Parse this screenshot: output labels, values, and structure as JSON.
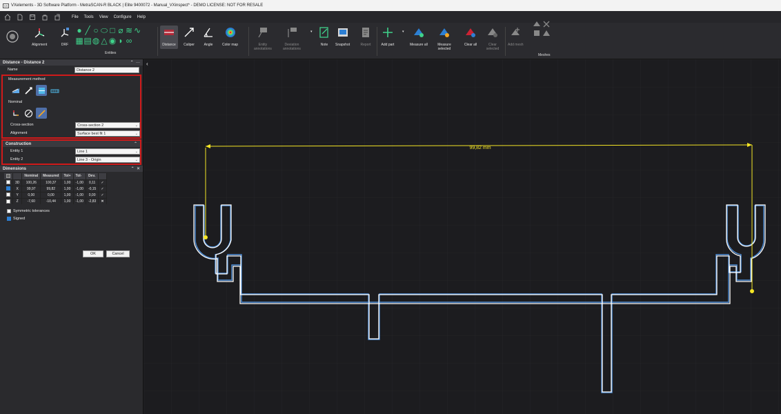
{
  "window": {
    "title": "VXelements - 3D Software Platform - MetraSCAN-R BLACK | Elite 9400072 - Manual_VXinspect* - DEMO LICENSE: NOT FOR RESALE",
    "logo_text": "VX"
  },
  "menu": [
    "File",
    "Tools",
    "View",
    "Configure",
    "Help"
  ],
  "ribbon": {
    "alignment": "Alignment",
    "drf": "DRF",
    "entities_group": "Entities",
    "distance": "Distance",
    "caliper": "Caliper",
    "angle": "Angle",
    "color_map": "Color map",
    "entity_annotations": "Entity\nannotations",
    "deviation_annotations": "Deviation\nannotations",
    "note": "Note",
    "snapshot": "Snapshot",
    "report": "Report",
    "add_part": "Add part",
    "measure_all": "Measure all",
    "measure_selected": "Measure\nselected",
    "clear_all": "Clear all",
    "clear_selected": "Clear\nselected",
    "add_mesh": "Add mesh",
    "meshes_group": "Meshes"
  },
  "panel": {
    "header": "Distance - Distance 2",
    "name_label": "Name",
    "name_value": "Distance 2",
    "measurement_method_label": "Measurement method",
    "nominal_label": "Nominal",
    "cross_section_label": "Cross-section",
    "cross_section_value": "Cross-section 2",
    "alignment_label": "Alignment",
    "alignment_value": "Surface best fit 1",
    "construction_header": "Construction",
    "entity1_label": "Entity 1",
    "entity1_value": "Line 1",
    "entity2_label": "Entity 2",
    "entity2_value": "Line 3 - Origin",
    "dimensions_header": "Dimensions",
    "table_headers": [
      "Nominal",
      "Measured",
      "Tol+",
      "Tol-",
      "Dev."
    ],
    "rows": [
      {
        "axis": "3D",
        "nominal": "100,26",
        "measured": "100,37",
        "tol_plus": "1,00",
        "tol_minus": "-1,00",
        "dev": "0,11",
        "status": "ok",
        "checked": false
      },
      {
        "axis": "X",
        "nominal": "99,97",
        "measured": "99,82",
        "tol_plus": "1,00",
        "tol_minus": "-1,00",
        "dev": "-0,15",
        "status": "ok",
        "checked": true
      },
      {
        "axis": "Y",
        "nominal": "0,00",
        "measured": "0,00",
        "tol_plus": "1,00",
        "tol_minus": "-1,00",
        "dev": "0,00",
        "status": "ok",
        "checked": false
      },
      {
        "axis": "Z",
        "nominal": "-7,60",
        "measured": "-10,44",
        "tol_plus": "1,00",
        "tol_minus": "-1,00",
        "dev": "-2,83",
        "status": "fail",
        "checked": false
      }
    ],
    "symmetric_tolerances": "Symmetric tolerances",
    "signed": "Signed",
    "ok_button": "OK",
    "cancel_button": "Cancel"
  },
  "viewport": {
    "dimension_label": "99,82 mm",
    "colors": {
      "dimension": "#f5e625",
      "profile_nominal": "#ffffff",
      "profile_measured": "#4f8fd8",
      "grid": "#2a2a2e"
    }
  }
}
